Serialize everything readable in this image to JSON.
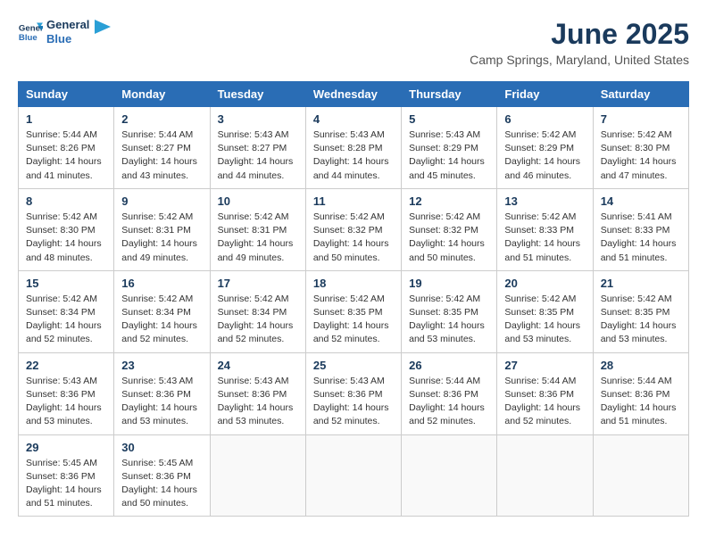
{
  "logo": {
    "line1": "General",
    "line2": "Blue"
  },
  "title": "June 2025",
  "location": "Camp Springs, Maryland, United States",
  "headers": [
    "Sunday",
    "Monday",
    "Tuesday",
    "Wednesday",
    "Thursday",
    "Friday",
    "Saturday"
  ],
  "weeks": [
    [
      {
        "day": "1",
        "sunrise": "5:44 AM",
        "sunset": "8:26 PM",
        "daylight": "14 hours and 41 minutes."
      },
      {
        "day": "2",
        "sunrise": "5:44 AM",
        "sunset": "8:27 PM",
        "daylight": "14 hours and 43 minutes."
      },
      {
        "day": "3",
        "sunrise": "5:43 AM",
        "sunset": "8:27 PM",
        "daylight": "14 hours and 44 minutes."
      },
      {
        "day": "4",
        "sunrise": "5:43 AM",
        "sunset": "8:28 PM",
        "daylight": "14 hours and 44 minutes."
      },
      {
        "day": "5",
        "sunrise": "5:43 AM",
        "sunset": "8:29 PM",
        "daylight": "14 hours and 45 minutes."
      },
      {
        "day": "6",
        "sunrise": "5:42 AM",
        "sunset": "8:29 PM",
        "daylight": "14 hours and 46 minutes."
      },
      {
        "day": "7",
        "sunrise": "5:42 AM",
        "sunset": "8:30 PM",
        "daylight": "14 hours and 47 minutes."
      }
    ],
    [
      {
        "day": "8",
        "sunrise": "5:42 AM",
        "sunset": "8:30 PM",
        "daylight": "14 hours and 48 minutes."
      },
      {
        "day": "9",
        "sunrise": "5:42 AM",
        "sunset": "8:31 PM",
        "daylight": "14 hours and 49 minutes."
      },
      {
        "day": "10",
        "sunrise": "5:42 AM",
        "sunset": "8:31 PM",
        "daylight": "14 hours and 49 minutes."
      },
      {
        "day": "11",
        "sunrise": "5:42 AM",
        "sunset": "8:32 PM",
        "daylight": "14 hours and 50 minutes."
      },
      {
        "day": "12",
        "sunrise": "5:42 AM",
        "sunset": "8:32 PM",
        "daylight": "14 hours and 50 minutes."
      },
      {
        "day": "13",
        "sunrise": "5:42 AM",
        "sunset": "8:33 PM",
        "daylight": "14 hours and 51 minutes."
      },
      {
        "day": "14",
        "sunrise": "5:41 AM",
        "sunset": "8:33 PM",
        "daylight": "14 hours and 51 minutes."
      }
    ],
    [
      {
        "day": "15",
        "sunrise": "5:42 AM",
        "sunset": "8:34 PM",
        "daylight": "14 hours and 52 minutes."
      },
      {
        "day": "16",
        "sunrise": "5:42 AM",
        "sunset": "8:34 PM",
        "daylight": "14 hours and 52 minutes."
      },
      {
        "day": "17",
        "sunrise": "5:42 AM",
        "sunset": "8:34 PM",
        "daylight": "14 hours and 52 minutes."
      },
      {
        "day": "18",
        "sunrise": "5:42 AM",
        "sunset": "8:35 PM",
        "daylight": "14 hours and 52 minutes."
      },
      {
        "day": "19",
        "sunrise": "5:42 AM",
        "sunset": "8:35 PM",
        "daylight": "14 hours and 53 minutes."
      },
      {
        "day": "20",
        "sunrise": "5:42 AM",
        "sunset": "8:35 PM",
        "daylight": "14 hours and 53 minutes."
      },
      {
        "day": "21",
        "sunrise": "5:42 AM",
        "sunset": "8:35 PM",
        "daylight": "14 hours and 53 minutes."
      }
    ],
    [
      {
        "day": "22",
        "sunrise": "5:43 AM",
        "sunset": "8:36 PM",
        "daylight": "14 hours and 53 minutes."
      },
      {
        "day": "23",
        "sunrise": "5:43 AM",
        "sunset": "8:36 PM",
        "daylight": "14 hours and 53 minutes."
      },
      {
        "day": "24",
        "sunrise": "5:43 AM",
        "sunset": "8:36 PM",
        "daylight": "14 hours and 53 minutes."
      },
      {
        "day": "25",
        "sunrise": "5:43 AM",
        "sunset": "8:36 PM",
        "daylight": "14 hours and 52 minutes."
      },
      {
        "day": "26",
        "sunrise": "5:44 AM",
        "sunset": "8:36 PM",
        "daylight": "14 hours and 52 minutes."
      },
      {
        "day": "27",
        "sunrise": "5:44 AM",
        "sunset": "8:36 PM",
        "daylight": "14 hours and 52 minutes."
      },
      {
        "day": "28",
        "sunrise": "5:44 AM",
        "sunset": "8:36 PM",
        "daylight": "14 hours and 51 minutes."
      }
    ],
    [
      {
        "day": "29",
        "sunrise": "5:45 AM",
        "sunset": "8:36 PM",
        "daylight": "14 hours and 51 minutes."
      },
      {
        "day": "30",
        "sunrise": "5:45 AM",
        "sunset": "8:36 PM",
        "daylight": "14 hours and 50 minutes."
      },
      null,
      null,
      null,
      null,
      null
    ]
  ]
}
